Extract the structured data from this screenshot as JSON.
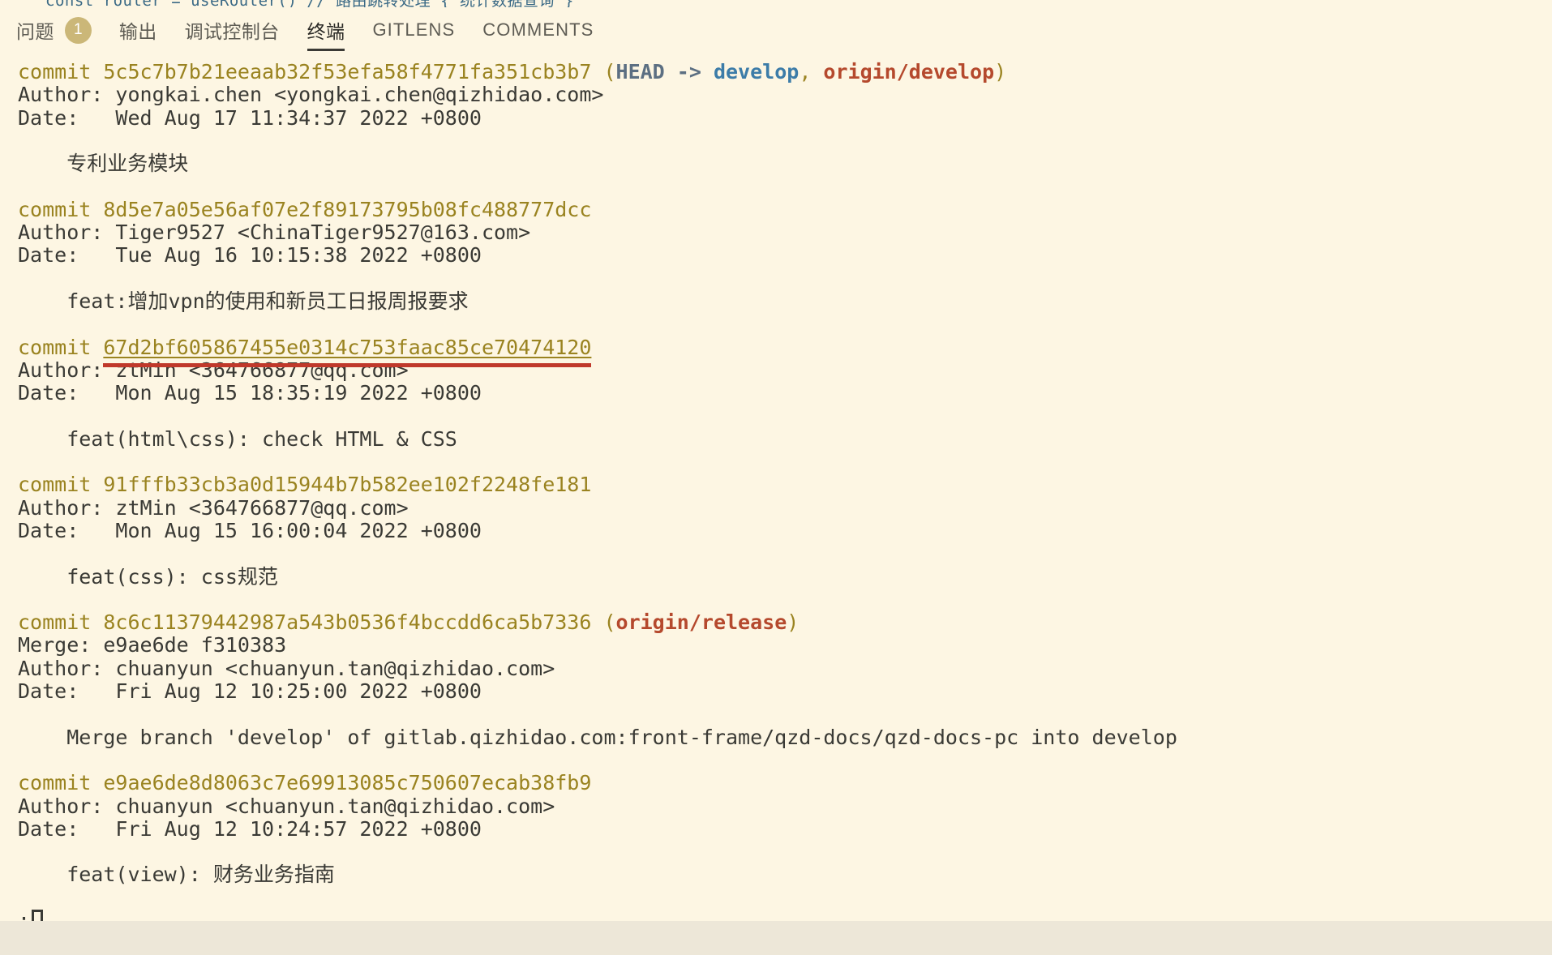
{
  "window": {
    "background_color": "#FDF6E3",
    "status_bar_color": "#EDE7D8"
  },
  "top_sliver": {
    "clipped_code_text": "const router = useRouter()   // 路由跳转处理   { 统计数据查询 }"
  },
  "panel_tabs": {
    "items": [
      {
        "label": "问题",
        "badge": "1",
        "active": false,
        "latin": false
      },
      {
        "label": "输出",
        "badge": null,
        "active": false,
        "latin": false
      },
      {
        "label": "调试控制台",
        "badge": null,
        "active": false,
        "latin": false
      },
      {
        "label": "终端",
        "badge": null,
        "active": true,
        "latin": false
      },
      {
        "label": "GITLENS",
        "badge": null,
        "active": false,
        "latin": true
      },
      {
        "label": "COMMENTS",
        "badge": null,
        "active": false,
        "latin": true
      }
    ]
  },
  "terminal": {
    "command_context": "git log",
    "colors": {
      "sha": "#9a8320",
      "head_ref": "#5c6f82",
      "local_branch": "#3c7ca8",
      "remote_branch": "#b5492d",
      "error_underline": "#c0392b",
      "text": "#3a3a35"
    },
    "commits": [
      {
        "commit_label": "commit ",
        "sha": "5c5c7b7b21eeaab32f53efa58f4771fa351cb3b7",
        "sha_underlined": false,
        "refs_open": " (",
        "ref_head": "HEAD -> ",
        "ref_local": "develop",
        "ref_sep": ", ",
        "ref_remote": "origin/develop",
        "refs_close": ")",
        "merge": null,
        "author": "Author: yongkai.chen <yongkai.chen@qizhidao.com>",
        "date": "Date:   Wed Aug 17 11:34:37 2022 +0800",
        "message": "    专利业务模块"
      },
      {
        "commit_label": "commit ",
        "sha": "8d5e7a05e56af07e2f89173795b08fc488777dcc",
        "sha_underlined": false,
        "refs_open": "",
        "ref_head": "",
        "ref_local": "",
        "ref_sep": "",
        "ref_remote": "",
        "refs_close": "",
        "merge": null,
        "author": "Author: Tiger9527 <ChinaTiger9527@163.com>",
        "date": "Date:   Tue Aug 16 10:15:38 2022 +0800",
        "message": "    feat:增加vpn的使用和新员工日报周报要求"
      },
      {
        "commit_label": "commit ",
        "sha": "67d2bf605867455e0314c753faac85ce70474120",
        "sha_underlined": true,
        "refs_open": "",
        "ref_head": "",
        "ref_local": "",
        "ref_sep": "",
        "ref_remote": "",
        "refs_close": "",
        "merge": null,
        "author": "Author: ztMin <364766877@qq.com>",
        "date": "Date:   Mon Aug 15 18:35:19 2022 +0800",
        "message": "    feat(html\\css): check HTML & CSS"
      },
      {
        "commit_label": "commit ",
        "sha": "91fffb33cb3a0d15944b7b582ee102f2248fe181",
        "sha_underlined": false,
        "refs_open": "",
        "ref_head": "",
        "ref_local": "",
        "ref_sep": "",
        "ref_remote": "",
        "refs_close": "",
        "merge": null,
        "author": "Author: ztMin <364766877@qq.com>",
        "date": "Date:   Mon Aug 15 16:00:04 2022 +0800",
        "message": "    feat(css): css规范"
      },
      {
        "commit_label": "commit ",
        "sha": "8c6c11379442987a543b0536f4bccdd6ca5b7336",
        "sha_underlined": false,
        "refs_open": " (",
        "ref_head": "",
        "ref_local": "",
        "ref_sep": "",
        "ref_remote": "origin/release",
        "refs_close": ")",
        "merge": "Merge: e9ae6de f310383",
        "author": "Author: chuanyun <chuanyun.tan@qizhidao.com>",
        "date": "Date:   Fri Aug 12 10:25:00 2022 +0800",
        "message": "    Merge branch 'develop' of gitlab.qizhidao.com:front-frame/qzd-docs/qzd-docs-pc into develop"
      },
      {
        "commit_label": "commit ",
        "sha": "e9ae6de8d8063c7e69913085c750607ecab38fb9",
        "sha_underlined": false,
        "refs_open": "",
        "ref_head": "",
        "ref_local": "",
        "ref_sep": "",
        "ref_remote": "",
        "refs_close": "",
        "merge": null,
        "author": "Author: chuanyun <chuanyun.tan@qizhidao.com>",
        "date": "Date:   Fri Aug 12 10:24:57 2022 +0800",
        "message": "    feat(view): 财务业务指南"
      }
    ],
    "pager_prompt": ":"
  }
}
